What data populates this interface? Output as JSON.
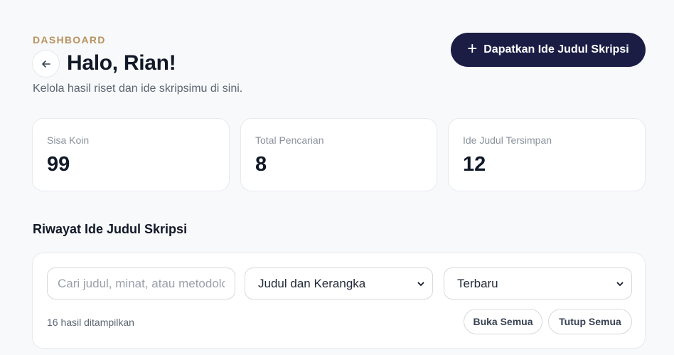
{
  "header": {
    "eyebrow": "DASHBOARD",
    "title": "Halo, Rian!",
    "subtitle": "Kelola hasil riset dan ide skripsimu di sini.",
    "primary_button": "Dapatkan Ide Judul Skripsi"
  },
  "stats": [
    {
      "label": "Sisa Koin",
      "value": "99"
    },
    {
      "label": "Total Pencarian",
      "value": "8"
    },
    {
      "label": "Ide Judul Tersimpan",
      "value": "12"
    }
  ],
  "history": {
    "title": "Riwayat Ide Judul Skripsi",
    "search_placeholder": "Cari judul, minat, atau metodologi",
    "filter_type": "Judul dan Kerangka",
    "sort": "Terbaru",
    "results_text": "16 hasil ditampilkan",
    "expand_all": "Buka Semua",
    "collapse_all": "Tutup Semua"
  },
  "icons": {
    "back": "arrow-left-icon",
    "add": "plus-icon",
    "dropdown": "chevron-down-icon"
  },
  "colors": {
    "accent": "#b8925e",
    "primary": "#1b1d45",
    "background": "#f8f9fb"
  }
}
